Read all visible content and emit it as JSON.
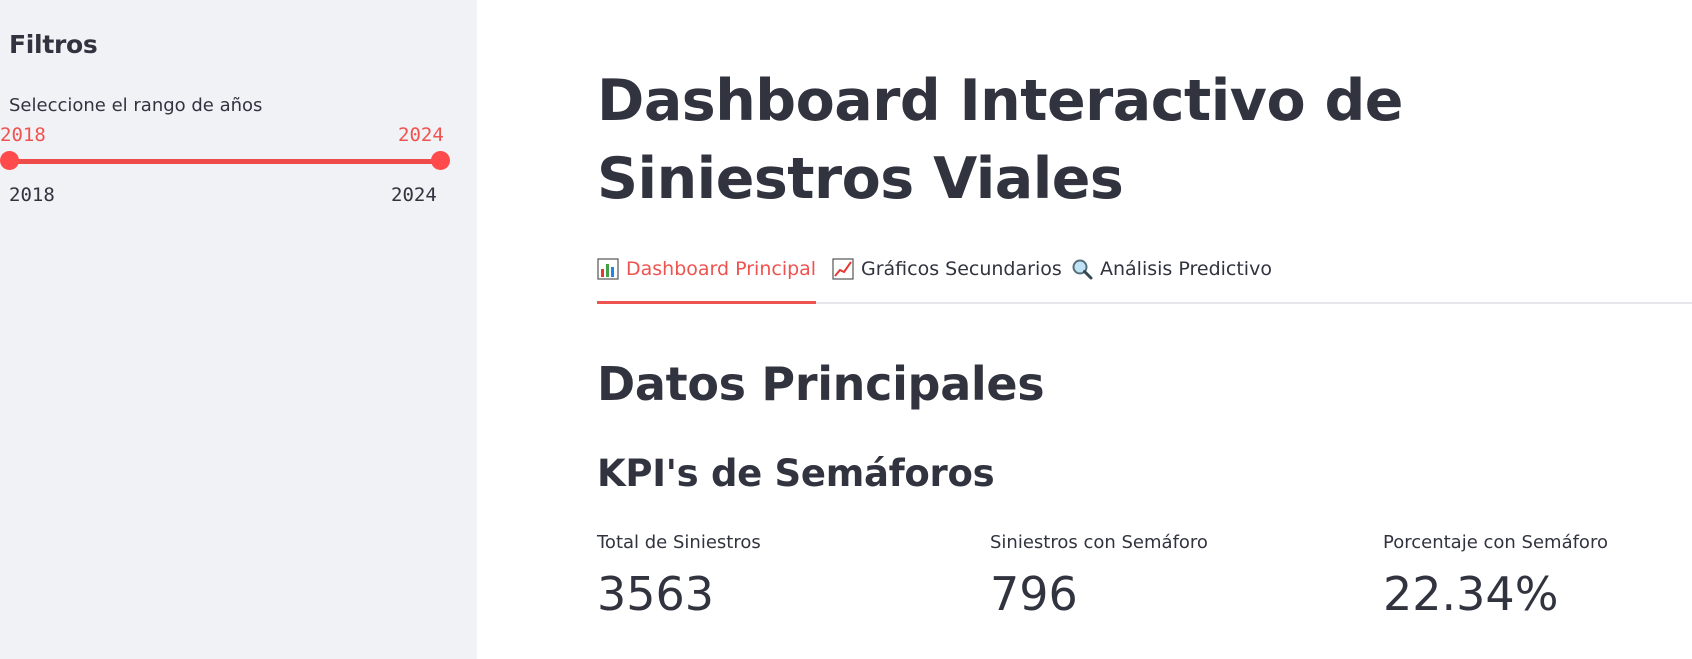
{
  "sidebar": {
    "title": "Filtros",
    "slider": {
      "label": "Seleccione el rango de años",
      "selected_min": "2018",
      "selected_max": "2024",
      "range_min": "2018",
      "range_max": "2024",
      "accent_color": "#ff4b4b"
    }
  },
  "main": {
    "title": "Dashboard Interactivo de Siniestros Viales",
    "tabs": [
      {
        "label": "Dashboard Principal",
        "icon": "bar-chart-icon",
        "active": true
      },
      {
        "label": "Gráficos Secundarios",
        "icon": "line-chart-icon",
        "active": false
      },
      {
        "label": "Análisis Predictivo",
        "icon": "magnifier-icon",
        "active": false
      }
    ],
    "section_title": "Datos Principales",
    "subsection_title": "KPI's de Semáforos",
    "metrics": [
      {
        "label": "Total de Siniestros",
        "value": "3563"
      },
      {
        "label": "Siniestros con Semáforo",
        "value": "796"
      },
      {
        "label": "Porcentaje con Semáforo",
        "value": "22.34%"
      }
    ]
  }
}
